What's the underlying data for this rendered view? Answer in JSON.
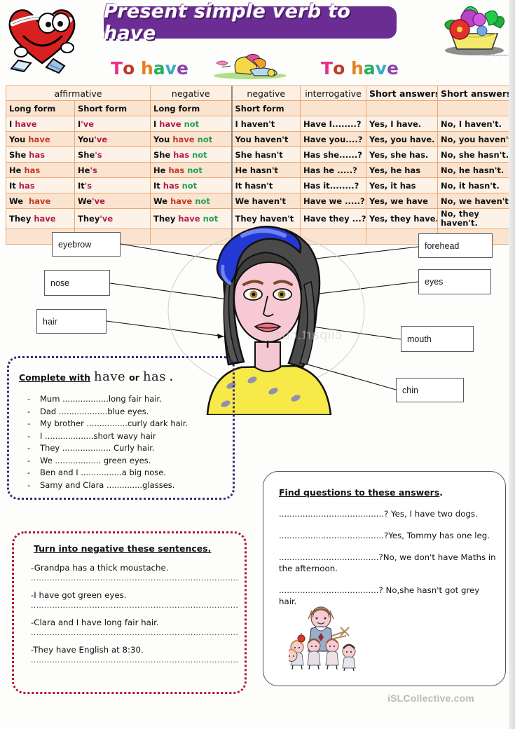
{
  "header": {
    "title": "Present simple verb to have",
    "to_have_left": "To have",
    "to_have_right": "To have",
    "heart_icon": "running-heart-icon",
    "flowers_icon": "flower-basket-icon",
    "middle_icon": "reclining-figure-icon",
    "banner_color": "#6b2d93"
  },
  "table": {
    "categories": [
      {
        "label": "affirmative",
        "color": "#3b3bbd",
        "span": 2
      },
      {
        "label": "negative",
        "color": "#3a7ea8",
        "span": 1
      },
      {
        "label": "negative",
        "color": "#3a7ea8",
        "span": 1
      },
      {
        "label": "interrogative",
        "color": "#2e9e63",
        "span": 1
      },
      {
        "label": "Short answers.",
        "color": "#111111",
        "span": 1
      },
      {
        "label": "Short answers",
        "color": "#111111",
        "span": 1
      }
    ],
    "subheaders": [
      "Long form",
      "Short form",
      "Long form",
      "Short form",
      "",
      "",
      ""
    ],
    "rows": [
      {
        "affirmative_long": "I have",
        "affirmative_short": "I've",
        "negative_long": "I have not",
        "negative_short": "I haven't",
        "interrogative": "Have I........?",
        "short_yes": "Yes, I have.",
        "short_no": "No, I haven't."
      },
      {
        "affirmative_long": "You have",
        "affirmative_short": "You've",
        "negative_long": "You have not",
        "negative_short": "You haven't",
        "interrogative": "Have you....?",
        "short_yes": "Yes, you have.",
        "short_no": "No, you haven't."
      },
      {
        "affirmative_long": "She has",
        "affirmative_short": "She's",
        "negative_long": "She has not",
        "negative_short": "She hasn't",
        "interrogative": "Has she......?",
        "short_yes": "Yes, she has.",
        "short_no": "No, she hasn't."
      },
      {
        "affirmative_long": "He has",
        "affirmative_short": "He's",
        "negative_long": "He has not",
        "negative_short": "He hasn't",
        "interrogative": "Has he .....?",
        "short_yes": "Yes, he has",
        "short_no": "No, he hasn't."
      },
      {
        "affirmative_long": "It has",
        "affirmative_short": "It's",
        "negative_long": "It has not",
        "negative_short": "It hasn't",
        "interrogative": "Has it........?",
        "short_yes": "Yes, it has",
        "short_no": "No, it hasn't."
      },
      {
        "affirmative_long": "We  have",
        "affirmative_short": "We've",
        "negative_long": "We have not",
        "negative_short": "We haven't",
        "interrogative": "Have we .....?",
        "short_yes": "Yes, we have",
        "short_no": "No, we haven't."
      },
      {
        "affirmative_long": "They have",
        "affirmative_short": "They've",
        "negative_long": "They have not",
        "negative_short": "They haven't",
        "interrogative": "Have they ...?",
        "short_yes": "Yes, they have.",
        "short_no": "No, they haven't."
      }
    ]
  },
  "diagram": {
    "labels_left": [
      "eyebrow",
      "nose",
      "hair"
    ],
    "labels_right": [
      "forehead",
      "eyes",
      "mouth",
      "chin"
    ],
    "watermark": "clipart.com",
    "face_icon": "woman-face-illustration"
  },
  "exercise_complete": {
    "title_before": "Complete with",
    "word_have": "have",
    "title_or": "or",
    "word_has": "has",
    "title_end": ".",
    "items": [
      "Mum ..................long fair hair.",
      "Dad ...................blue eyes.",
      "My brother ................curly  dark hair.",
      "I ...................short wavy hair",
      "They ................... Curly  hair.",
      "We .................. green eyes.",
      "Ben and I ................a big nose.",
      "Samy and Clara ..............glasses."
    ],
    "border_color": "#3a2a6e"
  },
  "exercise_negative": {
    "title": "Turn into negative these sentences.",
    "sentences": [
      "-Grandpa has a thick moustache.",
      "-I have got green eyes.",
      "-Clara and I have long fair hair.",
      "-They have English at 8:30."
    ],
    "answer_line": "..................................................................................",
    "border_color": "#b5122f"
  },
  "exercise_find": {
    "title_main": "Find questions to these answers",
    "title_end": ".",
    "items": [
      "........................................? Yes, I have two dogs.",
      "........................................?Yes, Tommy has one leg.",
      "......................................?No, we don't have Maths in the afternoon.",
      "......................................? No,she hasn't got grey hair."
    ],
    "kids_icon": "teacher-and-children-illustration"
  },
  "footer": {
    "watermark": "iSLCollective.com"
  }
}
